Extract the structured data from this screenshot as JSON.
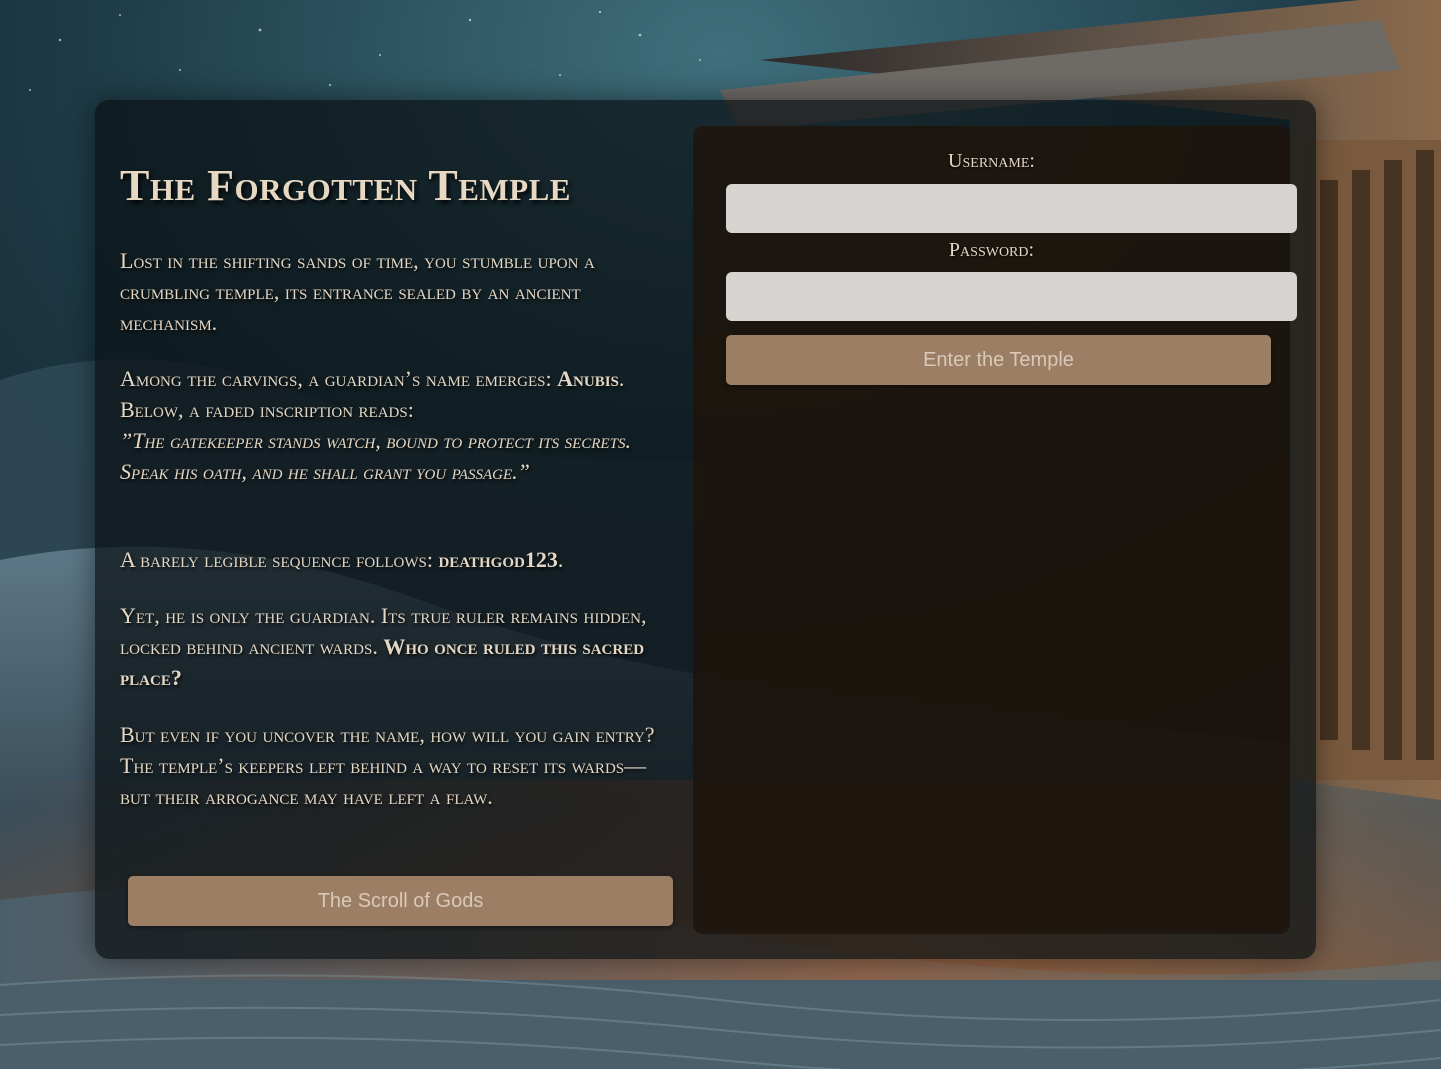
{
  "story": {
    "title": "The Forgotten Temple",
    "p1": "Lost in the shifting sands of time, you stumble upon a crumbling temple, its entrance sealed by an ancient mechanism.",
    "p2_intro": "Among the carvings, a guardian’s name emerges: ",
    "p2_name": "Anubis",
    "p2_after": ". Below, a faded inscription reads:",
    "p2_quote": "”The gatekeeper stands watch, bound to protect its secrets. Speak his oath, and he shall grant you passage.”",
    "p3_intro": "A barely legible sequence follows: ",
    "p3_code": "deathgod123",
    "p3_end": ".",
    "p4_text": "Yet, he is only the guardian. Its true ruler remains hidden, locked behind ancient wards. ",
    "p4_question": "Who once ruled this sacred place?",
    "p5": "But even if you uncover the name, how will you gain entry? The temple’s keepers left behind a way to reset its wards—but their arrogance may have left a flaw.",
    "scroll_button": "The Scroll of Gods"
  },
  "login": {
    "username_label": "Username:",
    "username_value": "",
    "password_label": "Password:",
    "password_value": "",
    "submit_label": "Enter the Temple"
  },
  "colors": {
    "button": "#9c7e65",
    "button_text": "#d8c9b8",
    "input_bg": "#d6d3d1",
    "text": "#e4d7c4"
  }
}
